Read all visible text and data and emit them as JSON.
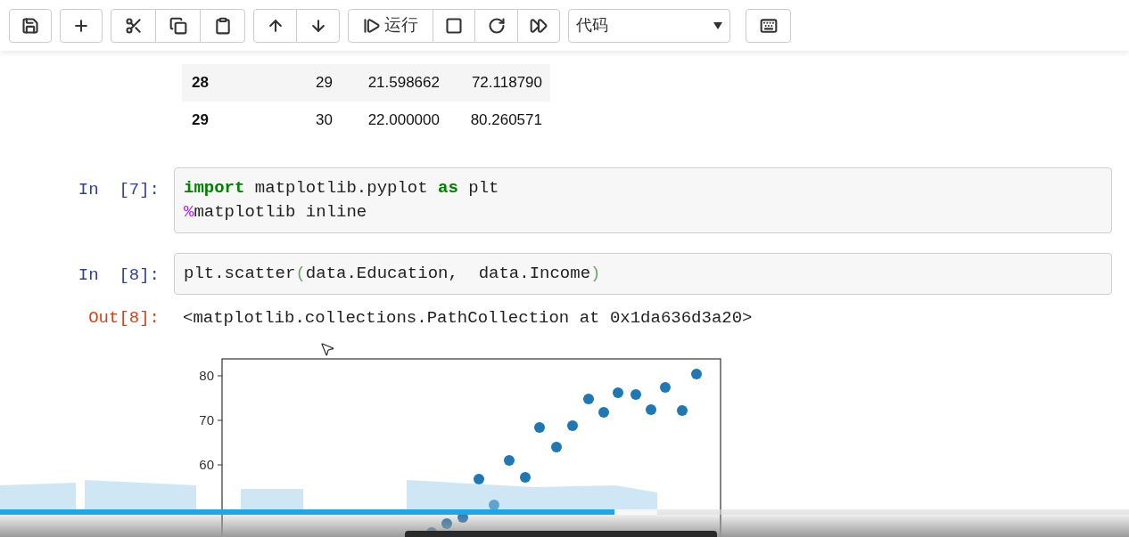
{
  "toolbar": {
    "run_label": "运行",
    "cell_type": "代码"
  },
  "table": {
    "rows": [
      {
        "index": "28",
        "cells": [
          "29",
          "21.598662",
          "72.118790"
        ]
      },
      {
        "index": "29",
        "cells": [
          "30",
          "22.000000",
          "80.260571"
        ]
      }
    ]
  },
  "cells": [
    {
      "prompt": "In  [7]:",
      "lines": [
        [
          {
            "text": "import",
            "kind": "keyword"
          },
          {
            "text": " matplotlib.pyplot ",
            "kind": "plain"
          },
          {
            "text": "as",
            "kind": "keyword"
          },
          {
            "text": " plt",
            "kind": "plain"
          }
        ],
        [
          {
            "text": "%",
            "kind": "magic"
          },
          {
            "text": "matplotlib inline",
            "kind": "plain"
          }
        ]
      ]
    },
    {
      "prompt": "In  [8]:",
      "lines": [
        [
          {
            "text": "plt.scatter",
            "kind": "plain"
          },
          {
            "text": "(",
            "kind": "paren"
          },
          {
            "text": "data.Education,  data.Income",
            "kind": "plain"
          },
          {
            "text": ")",
            "kind": "paren"
          }
        ]
      ],
      "output": {
        "prompt": "Out[8]:",
        "text": "<matplotlib.collections.PathCollection at 0x1da636d3a20>"
      },
      "plot": {
        "y_tick_labels": [
          "80",
          "70",
          "60"
        ]
      }
    }
  ],
  "video_player": {
    "progress": {
      "level": 0.544
    },
    "buffered": {
      "level": 0.582
    }
  }
}
